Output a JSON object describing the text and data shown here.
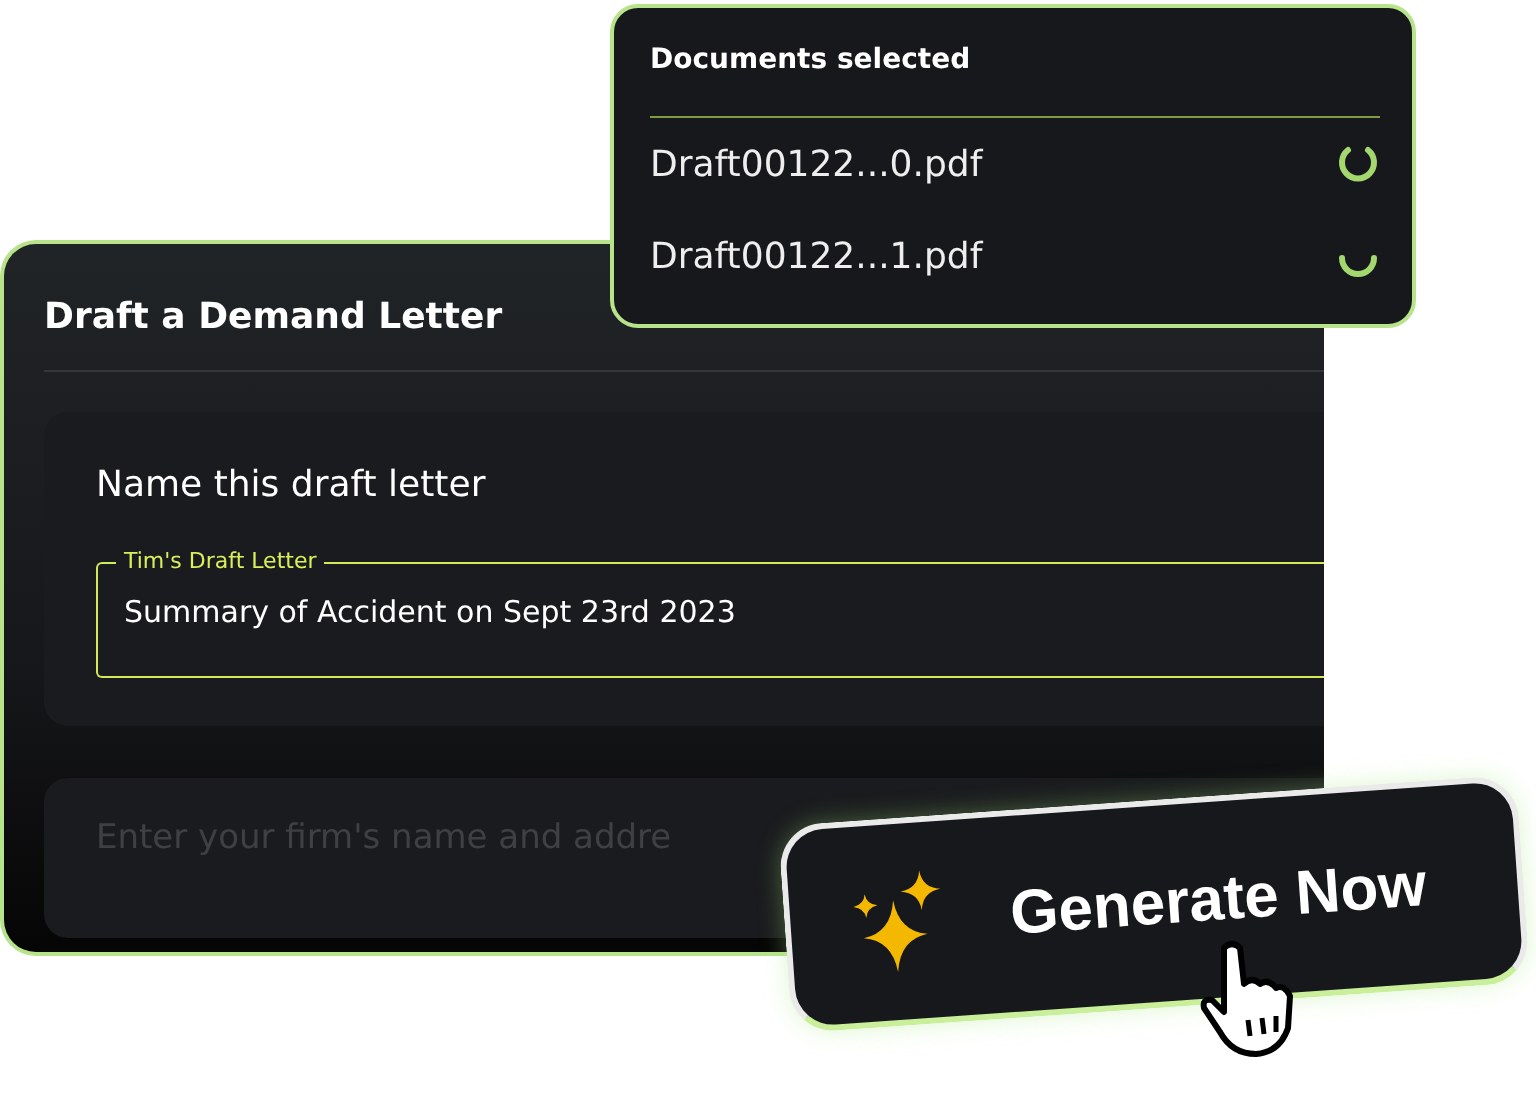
{
  "main_card": {
    "title": "Draft a Demand Letter",
    "name_section": {
      "heading": "Name this draft letter",
      "field": {
        "label": "Tim's Draft Letter",
        "value": "Summary of Accident on Sept 23rd 2023"
      }
    },
    "address_section": {
      "placeholder": "Enter your firm's name and addre"
    }
  },
  "documents_popup": {
    "title": "Documents selected",
    "files": [
      {
        "name": "Draft00122...0.pdf"
      },
      {
        "name": "Draft00122...1.pdf"
      }
    ]
  },
  "generate_button": {
    "label": "Generate Now"
  }
}
